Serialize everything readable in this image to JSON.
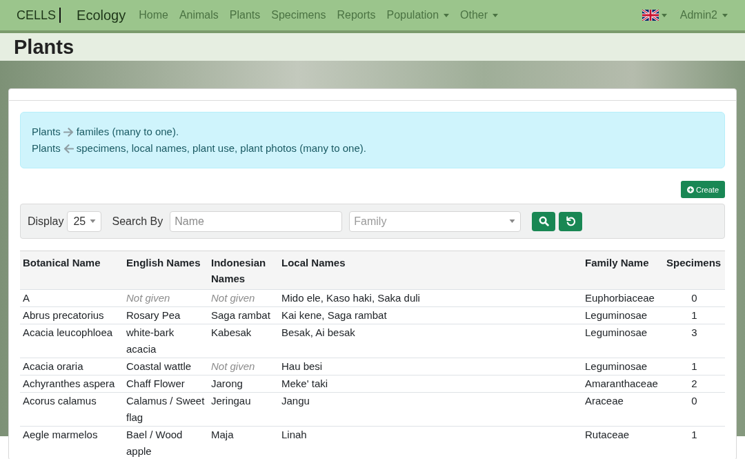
{
  "navbar": {
    "brand": "CELLS",
    "app_name": "Ecology",
    "links": [
      {
        "label": "Home",
        "has_menu": false
      },
      {
        "label": "Animals",
        "has_menu": false
      },
      {
        "label": "Plants",
        "has_menu": false
      },
      {
        "label": "Specimens",
        "has_menu": false
      },
      {
        "label": "Reports",
        "has_menu": false
      },
      {
        "label": "Population",
        "has_menu": true
      },
      {
        "label": "Other",
        "has_menu": true
      }
    ],
    "language": {
      "has_menu": true
    },
    "user": {
      "label": "Admin2",
      "has_menu": true
    }
  },
  "page": {
    "title": "Plants"
  },
  "info": {
    "lines": [
      {
        "subject": "Plants",
        "kind": "outgoing",
        "text": "familes (many to one)."
      },
      {
        "subject": "Plants",
        "kind": "incoming",
        "text": "specimens, local names, plant use, plant photos (many to one)."
      }
    ]
  },
  "actions": {
    "create": "Create"
  },
  "filters": {
    "display_label": "Display",
    "display_value": "25",
    "search_label": "Search By",
    "name_field": {
      "placeholder": "Name"
    },
    "family_field": {
      "placeholder": "Family"
    }
  },
  "table": {
    "columns": [
      {
        "label": "Botanical Name",
        "kind": "text"
      },
      {
        "label": "English Names",
        "kind": "text"
      },
      {
        "label": "Indonesian Names",
        "kind": "text"
      },
      {
        "label": "Local Names",
        "kind": "text"
      },
      {
        "label": "Family Name",
        "kind": "text"
      },
      {
        "label": "Specimens",
        "kind": "count"
      }
    ],
    "rows": [
      {
        "cells": [
          {
            "text": "A",
            "missing": false
          },
          {
            "text": "Not given",
            "missing": true
          },
          {
            "text": "Not given",
            "missing": true
          },
          {
            "text": "Mido ele, Kaso haki, Saka duli",
            "missing": false
          },
          {
            "text": "Euphorbiaceae",
            "missing": false
          },
          {
            "text": "0",
            "missing": false
          }
        ]
      },
      {
        "cells": [
          {
            "text": "Abrus precatorius",
            "missing": false
          },
          {
            "text": "Rosary Pea",
            "missing": false
          },
          {
            "text": "Saga rambat",
            "missing": false
          },
          {
            "text": "Kai kene, Saga rambat",
            "missing": false
          },
          {
            "text": "Leguminosae",
            "missing": false
          },
          {
            "text": "1",
            "missing": false
          }
        ]
      },
      {
        "cells": [
          {
            "text": "Acacia leucophloea",
            "missing": false
          },
          {
            "text": "white-bark acacia",
            "missing": false
          },
          {
            "text": "Kabesak",
            "missing": false
          },
          {
            "text": "Besak, Ai besak",
            "missing": false
          },
          {
            "text": "Leguminosae",
            "missing": false
          },
          {
            "text": "3",
            "missing": false
          }
        ]
      },
      {
        "cells": [
          {
            "text": "Acacia oraria",
            "missing": false
          },
          {
            "text": "Coastal wattle",
            "missing": false
          },
          {
            "text": "Not given",
            "missing": true
          },
          {
            "text": "Hau besi",
            "missing": false
          },
          {
            "text": "Leguminosae",
            "missing": false
          },
          {
            "text": "1",
            "missing": false
          }
        ]
      },
      {
        "cells": [
          {
            "text": "Achyranthes aspera",
            "missing": false
          },
          {
            "text": "Chaff Flower",
            "missing": false
          },
          {
            "text": "Jarong",
            "missing": false
          },
          {
            "text": "Meke' taki",
            "missing": false
          },
          {
            "text": "Amaranthaceae",
            "missing": false
          },
          {
            "text": "2",
            "missing": false
          }
        ]
      },
      {
        "cells": [
          {
            "text": "Acorus calamus",
            "missing": false
          },
          {
            "text": "Calamus / Sweet flag",
            "missing": false
          },
          {
            "text": "Jeringau",
            "missing": false
          },
          {
            "text": "Jangu",
            "missing": false
          },
          {
            "text": "Araceae",
            "missing": false
          },
          {
            "text": "0",
            "missing": false
          }
        ]
      },
      {
        "cells": [
          {
            "text": "Aegle marmelos",
            "missing": false
          },
          {
            "text": "Bael / Wood apple",
            "missing": false
          },
          {
            "text": "Maja",
            "missing": false
          },
          {
            "text": "Linah",
            "missing": false
          },
          {
            "text": "Rutaceae",
            "missing": false
          },
          {
            "text": "1",
            "missing": false
          }
        ]
      }
    ]
  }
}
